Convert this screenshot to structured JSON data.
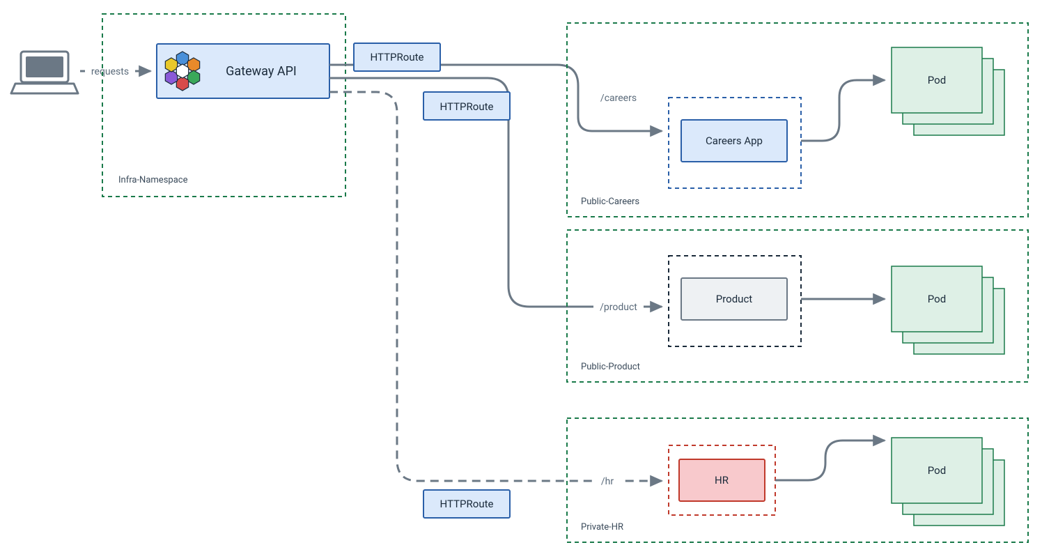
{
  "diagram": {
    "client": {
      "label": "requests"
    },
    "infra": {
      "namespace_label": "Infra-Namespace",
      "gateway_label": "Gateway API"
    },
    "routes": {
      "r1": "HTTPRoute",
      "r2": "HTTPRoute",
      "r3": "HTTPRoute"
    },
    "careers": {
      "namespace_label": "Public-Careers",
      "path_label": "/careers",
      "app_label": "Careers App",
      "pod_label": "Pod"
    },
    "product": {
      "namespace_label": "Public-Product",
      "path_label": "/product",
      "app_label": "Product",
      "pod_label": "Pod"
    },
    "hr": {
      "namespace_label": "Private-HR",
      "path_label": "/hr",
      "app_label": "HR",
      "pod_label": "Pod"
    }
  }
}
